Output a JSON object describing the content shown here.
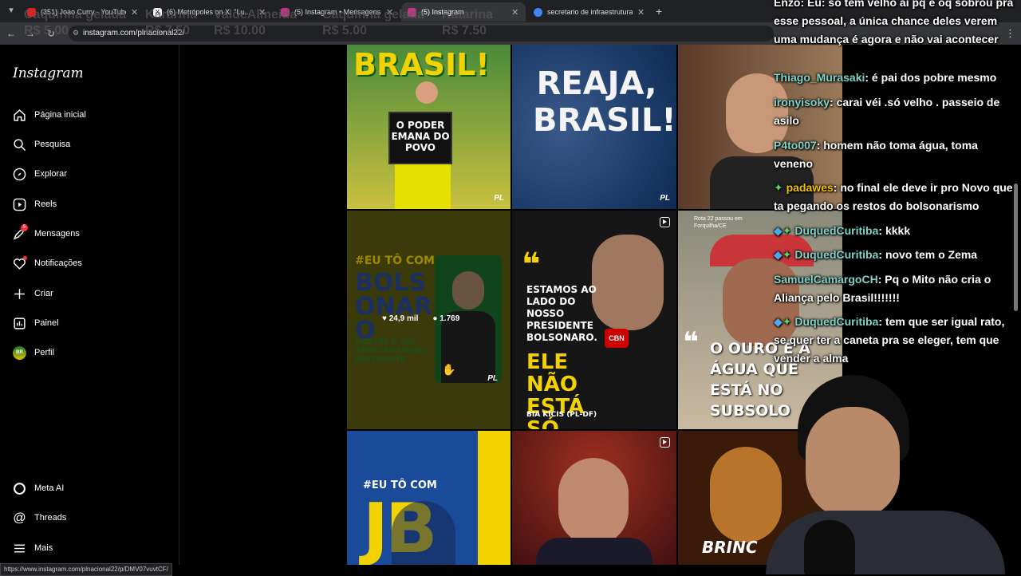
{
  "browser": {
    "tabs": [
      {
        "title": "(351) Joao Curry - YouTube",
        "color": "#e02020"
      },
      {
        "title": "(6) Metrópoles on X: \"Lu...",
        "color": "#111111"
      },
      {
        "title": "(5) Instagram • Mensagens",
        "color": "#c13584"
      },
      {
        "title": "(5) Instagram",
        "color": "#c13584"
      },
      {
        "title": "secretario de infraestrutura cur...",
        "color": "#4285f4"
      }
    ],
    "url": "instagram.com/plnacional22/",
    "status_url": "https://www.instagram.com/plnacional22/p/DMV07vuvtCF/"
  },
  "ghost_banner": [
    "Caquinha gelada",
    "R$ 5.00",
    "Kararina",
    "R$ 7.50",
    "ValdeAlmeida",
    "R$ 10.00",
    "Caquinha gelada",
    "R$ 5.00",
    "Katarina",
    "R$ 7.50"
  ],
  "sidebar": {
    "logo": "Instagram",
    "items": [
      {
        "label": "Página inicial",
        "icon": "home-icon"
      },
      {
        "label": "Pesquisa",
        "icon": "search-icon"
      },
      {
        "label": "Explorar",
        "icon": "compass-icon"
      },
      {
        "label": "Reels",
        "icon": "reels-icon"
      },
      {
        "label": "Mensagens",
        "icon": "messenger-icon",
        "badge": "5"
      },
      {
        "label": "Notificações",
        "icon": "heart-icon"
      },
      {
        "label": "Criar",
        "icon": "plus-icon"
      },
      {
        "label": "Painel",
        "icon": "dashboard-icon"
      },
      {
        "label": "Perfil",
        "icon": "avatar-icon"
      }
    ],
    "bottom": [
      {
        "label": "Meta AI",
        "icon": "meta-ai-icon"
      },
      {
        "label": "Threads",
        "icon": "threads-icon"
      },
      {
        "label": "Mais",
        "icon": "menu-icon"
      }
    ]
  },
  "posts": {
    "p1": {
      "headline": "BRASIL!",
      "sign": "O PODER EMANA DO POVO",
      "brand": "PL"
    },
    "p2": {
      "headline": "REAJA, BRASIL!",
      "brand": "PL"
    },
    "p4": {
      "tag": "#EU TÔ COM",
      "name": "BOLSONARO",
      "sub": "MOSTRE O SEU APOIO AO NOSSO PRESIDENTE",
      "brand": "PL",
      "likes": "24,9 mil",
      "comments": "1.769"
    },
    "p5": {
      "quote": "ESTAMOS AO LADO DO NOSSO PRESIDENTE BOLSONARO.",
      "headline": "ELE NÃO ESTÁ SÓ",
      "author": "BIA KICIS (PL-DF)",
      "mic": "CBN"
    },
    "p6": {
      "badge": "Rota 22 passou em Forquilha/CE",
      "quote": "O OURO É A ÁGUA QUE ESTÁ NO SUBSOLO"
    },
    "p7": {
      "tag": "#EU TÔ COM",
      "initials": "JB"
    },
    "p9": {
      "text": "BRINC"
    }
  },
  "chat": [
    {
      "text_only": "Enzo: Eu: só tem velho aí pq é oq sobrou pra esse pessoal, a única chance deles verem uma mudança é agora e não vai acontecer"
    },
    {
      "user": "Thiago_Murasaki",
      "text": ": é pai dos pobre mesmo"
    },
    {
      "user": "ironyisoky",
      "text": ": carai véi .só velho . passeio de asilo"
    },
    {
      "user": "P4to007",
      "text": ": homem não toma água, toma veneno"
    },
    {
      "user": "padawes",
      "text": ": no final ele deve ir pro Novo que ta pegando os restos do bolsonarismo",
      "badges": [
        "spark"
      ]
    },
    {
      "user": "DuquedCuritiba",
      "text": ": kkkk",
      "badges": [
        "cube",
        "spark"
      ]
    },
    {
      "user": "DuquedCuritiba",
      "text": ": novo tem o Zema",
      "badges": [
        "cube",
        "spark"
      ]
    },
    {
      "user": "SamuelCamargoCH",
      "text": ": Pq o Mito não cria o Aliança pelo Brasil!!!!!!!"
    },
    {
      "user": "DuquedCuritiba",
      "text": ": tem que ser igual rato, se quer ter a caneta pra se eleger, tem que vender a alma",
      "badges": [
        "cube",
        "spark"
      ]
    }
  ],
  "colors": {
    "ig_bg": "#000000",
    "chat_user": "#7fd3c9",
    "badge_red": "#ff3040",
    "pl_yellow": "#f2d200",
    "pl_green": "#1a9a3a",
    "pl_blue": "#0d3a7a"
  }
}
